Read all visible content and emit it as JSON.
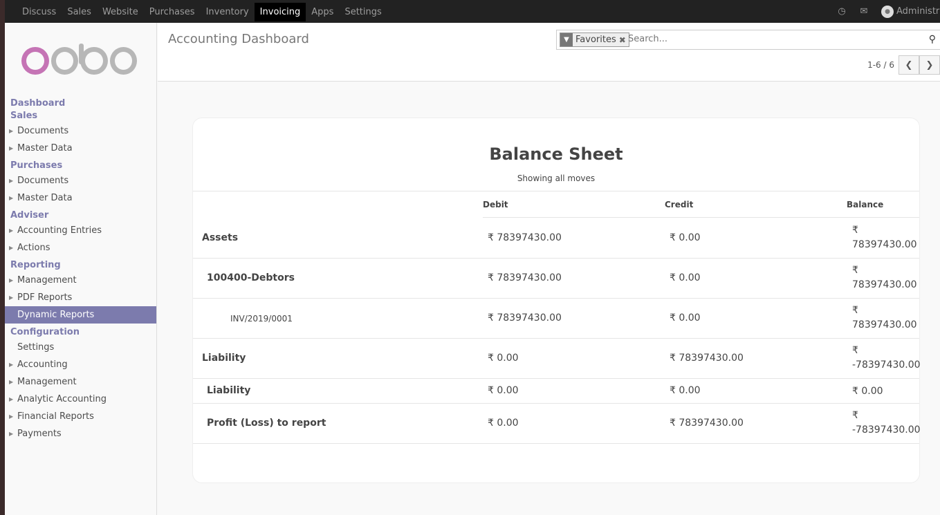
{
  "topbar": {
    "apps": [
      "Discuss",
      "Sales",
      "Website",
      "Purchases",
      "Inventory",
      "Invoicing",
      "Apps",
      "Settings"
    ],
    "active_app": "Invoicing",
    "user": "Administrator",
    "icons": [
      "clock-icon",
      "chat-icon"
    ]
  },
  "sidebar": {
    "logo_text": "odoo",
    "sections": [
      {
        "title": "Dashboard",
        "items": []
      },
      {
        "title": "Sales",
        "items": [
          {
            "label": "Documents",
            "caret": true
          },
          {
            "label": "Master Data",
            "caret": true
          }
        ]
      },
      {
        "title": "Purchases",
        "items": [
          {
            "label": "Documents",
            "caret": true
          },
          {
            "label": "Master Data",
            "caret": true
          }
        ]
      },
      {
        "title": "Adviser",
        "items": [
          {
            "label": "Accounting Entries",
            "caret": true
          },
          {
            "label": "Actions",
            "caret": true
          }
        ]
      },
      {
        "title": "Reporting",
        "items": [
          {
            "label": "Management",
            "caret": true
          },
          {
            "label": "PDF Reports",
            "caret": true
          },
          {
            "label": "Dynamic Reports",
            "caret": false,
            "active": true
          }
        ]
      },
      {
        "title": "Configuration",
        "items": [
          {
            "label": "Settings",
            "caret": false
          },
          {
            "label": "Accounting",
            "caret": true
          },
          {
            "label": "Management",
            "caret": true
          },
          {
            "label": "Analytic Accounting",
            "caret": true
          },
          {
            "label": "Financial Reports",
            "caret": true
          },
          {
            "label": "Payments",
            "caret": true
          }
        ]
      }
    ]
  },
  "control_panel": {
    "title": "Accounting Dashboard",
    "facet_label": "Favorites",
    "search_placeholder": "Search...",
    "pager_value": "1-6 / 6"
  },
  "report": {
    "title": "Balance Sheet",
    "subtitle": "Showing all moves",
    "columns": {
      "debit": "Debit",
      "credit": "Credit",
      "balance": "Balance"
    },
    "rows": [
      {
        "name": "Assets",
        "level": 0,
        "debit": "₹ 78397430.00",
        "credit": "₹ 0.00",
        "balance_symbol": "₹",
        "balance_value": "78397430.00"
      },
      {
        "name": "100400-Debtors",
        "level": 1,
        "debit": "₹ 78397430.00",
        "credit": "₹ 0.00",
        "balance_symbol": "₹",
        "balance_value": "78397430.00"
      },
      {
        "name": "INV/2019/0001",
        "level": 2,
        "debit": "₹ 78397430.00",
        "credit": "₹ 0.00",
        "balance_symbol": "₹",
        "balance_value": "78397430.00"
      },
      {
        "name": "Liability",
        "level": 0,
        "debit": "₹ 0.00",
        "credit": "₹ 78397430.00",
        "balance_symbol": "₹",
        "balance_value": "-78397430.00"
      },
      {
        "name": "Liability",
        "level": 1,
        "debit": "₹ 0.00",
        "credit": "₹ 0.00",
        "balance_symbol": "",
        "balance_value": "₹ 0.00"
      },
      {
        "name": "Profit (Loss) to report",
        "level": 1,
        "debit": "₹ 0.00",
        "credit": "₹ 78397430.00",
        "balance_symbol": "₹",
        "balance_value": "-78397430.00"
      }
    ]
  }
}
